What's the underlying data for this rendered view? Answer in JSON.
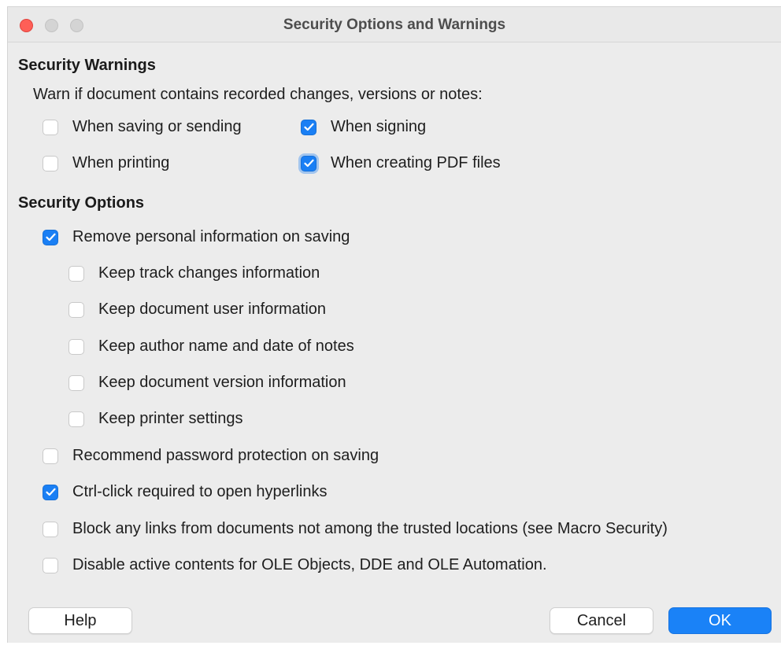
{
  "window": {
    "title": "Security Options and Warnings"
  },
  "warnings": {
    "heading": "Security Warnings",
    "intro": "Warn if document contains recorded changes, versions or notes:",
    "options": [
      {
        "label": "When saving or sending",
        "checked": false
      },
      {
        "label": "When signing",
        "checked": true
      },
      {
        "label": "When printing",
        "checked": false
      },
      {
        "label": "When creating PDF files",
        "checked": true
      }
    ]
  },
  "security": {
    "heading": "Security Options",
    "remove_personal": {
      "label": "Remove personal information on saving",
      "checked": true
    },
    "keep_options": [
      {
        "label": "Keep track changes information",
        "checked": false
      },
      {
        "label": "Keep document user information",
        "checked": false
      },
      {
        "label": "Keep author name and date of notes",
        "checked": false
      },
      {
        "label": "Keep document version information",
        "checked": false
      },
      {
        "label": "Keep printer settings",
        "checked": false
      }
    ],
    "other_options": [
      {
        "label": "Recommend password protection on saving",
        "checked": false
      },
      {
        "label": "Ctrl-click required to open hyperlinks",
        "checked": true
      },
      {
        "label": "Block any links from documents not among the trusted locations (see Macro Security)",
        "checked": false
      },
      {
        "label": "Disable active contents for OLE Objects, DDE and OLE Automation.",
        "checked": false
      }
    ]
  },
  "buttons": {
    "help": "Help",
    "cancel": "Cancel",
    "ok": "OK"
  },
  "colors": {
    "accent": "#1a82f7",
    "close": "#fe5f57",
    "window_bg": "#ececec"
  }
}
